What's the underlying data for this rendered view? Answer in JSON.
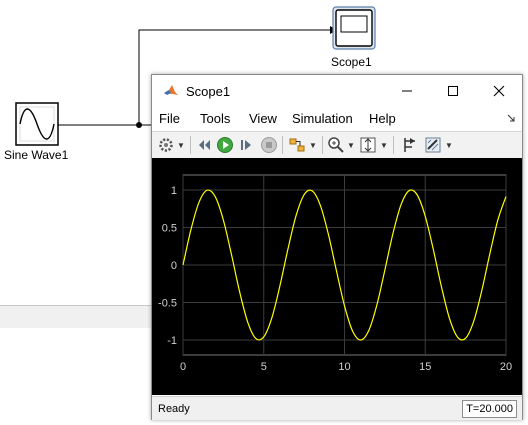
{
  "model": {
    "source_block_label": "Sine Wave1",
    "scope_block_label": "Scope1"
  },
  "window": {
    "title": "Scope1",
    "controls": [
      "minimize-icon",
      "maximize-icon",
      "close-icon"
    ]
  },
  "menu": {
    "items": [
      "File",
      "Tools",
      "View",
      "Simulation",
      "Help"
    ]
  },
  "toolbar": {
    "icons": [
      "gear-icon",
      "step-back-icon",
      "run-icon",
      "step-forward-icon",
      "stop-icon",
      "highlight-icon",
      "zoom-in-icon",
      "scale-axes-icon",
      "cursor-measure-icon",
      "triggers-icon"
    ]
  },
  "status": {
    "text": "Ready",
    "time": "T=20.000"
  },
  "colors": {
    "plot_background": "#000000",
    "trace": "#ffff00",
    "grid": "#3c3c3c"
  },
  "chart_data": {
    "type": "line",
    "title": "",
    "xlabel": "",
    "ylabel": "",
    "xlim": [
      0,
      20
    ],
    "ylim": [
      -1.2,
      1.2
    ],
    "xticks": [
      "0",
      "5",
      "10",
      "15",
      "20"
    ],
    "yticks": [
      "1",
      "0.5",
      "0",
      "-0.5",
      "-1"
    ],
    "grid": true,
    "series": [
      {
        "x": [
          0,
          0.5,
          1,
          1.5,
          2,
          2.5,
          3,
          3.5,
          4,
          4.5,
          5,
          5.5,
          6,
          6.5,
          7,
          7.5,
          8,
          8.5,
          9,
          9.5,
          10,
          10.5,
          11,
          11.5,
          12,
          12.5,
          13,
          13.5,
          14,
          14.5,
          15,
          15.5,
          16,
          16.5,
          17,
          17.5,
          18,
          18.5,
          19,
          19.5,
          20
        ],
        "values": [
          0,
          0.479,
          0.841,
          0.997,
          0.909,
          0.598,
          0.141,
          -0.351,
          -0.757,
          -0.978,
          -0.959,
          -0.706,
          -0.279,
          0.215,
          0.657,
          0.938,
          0.989,
          0.798,
          0.412,
          -0.075,
          -0.544,
          -0.88,
          -1,
          -0.875,
          -0.537,
          -0.066,
          0.42,
          0.804,
          0.991,
          0.935,
          0.65,
          0.206,
          -0.288,
          -0.712,
          -0.961,
          -0.976,
          -0.751,
          -0.342,
          0.15,
          0.604,
          0.913
        ]
      }
    ]
  }
}
